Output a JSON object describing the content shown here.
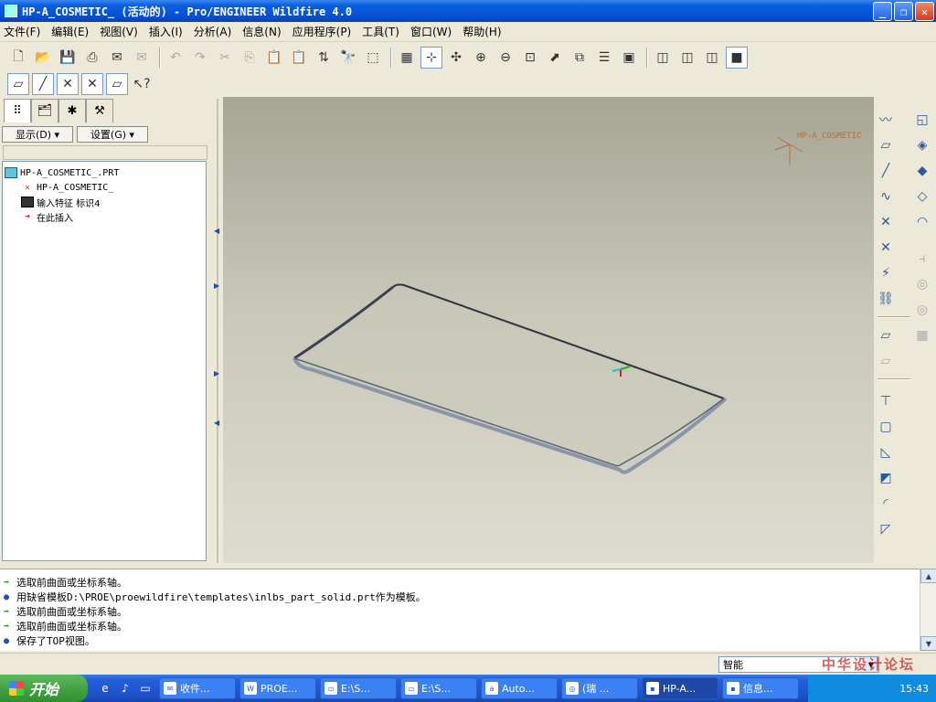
{
  "window": {
    "title": "HP-A_COSMETIC_ (活动的) - Pro/ENGINEER Wildfire 4.0",
    "min": "_",
    "max": "❐",
    "close": "✕"
  },
  "menu": [
    "文件(F)",
    "编辑(E)",
    "视图(V)",
    "插入(I)",
    "分析(A)",
    "信息(N)",
    "应用程序(P)",
    "工具(T)",
    "窗口(W)",
    "帮助(H)"
  ],
  "panel": {
    "show_label": "显示(D) ▾",
    "settings_label": "设置(G) ▾"
  },
  "tree": [
    {
      "icon": "part-icon",
      "label": "HP-A_COSMETIC_.PRT"
    },
    {
      "icon": "csys-icon",
      "label": "HP-A_COSMETIC_"
    },
    {
      "icon": "import-feature-icon",
      "label": "输入特征 标识4"
    },
    {
      "icon": "insert-here-icon",
      "label": "在此插入"
    }
  ],
  "viewport": {
    "csys_label": "HP-A_COSMETIC"
  },
  "messages": [
    {
      "type": "arrow",
      "text": "选取前曲面或坐标系轴。"
    },
    {
      "type": "dot",
      "text": "用缺省模板D:\\PROE\\proewildfire\\templates\\inlbs_part_solid.prt作为模板。"
    },
    {
      "type": "arrow",
      "text": "选取前曲面或坐标系轴。"
    },
    {
      "type": "arrow",
      "text": "选取前曲面或坐标系轴。"
    },
    {
      "type": "dot",
      "text": "保存了TOP视图。"
    }
  ],
  "status": {
    "filter": "智能"
  },
  "taskbar": {
    "start": "开始",
    "tasks": [
      "收件...",
      "PROE...",
      "E:\\S...",
      "E:\\S...",
      "Auto...",
      "(瑞 ...",
      "HP-A...",
      "信息..."
    ],
    "clock": "15:43"
  },
  "watermark": "中华设计论坛"
}
